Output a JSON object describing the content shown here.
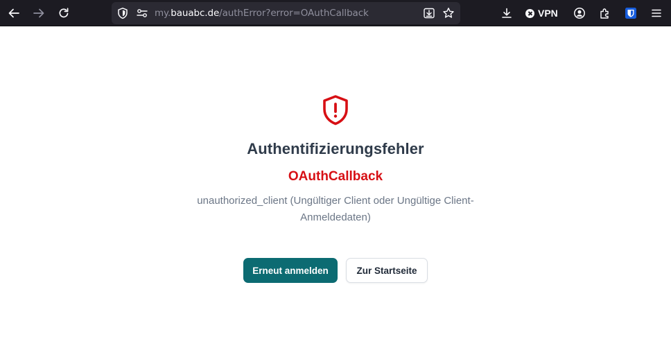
{
  "browser": {
    "url_prefix": "my.",
    "url_host": "bauabc.de",
    "url_path": "/authError?error=OAuthCallback",
    "vpn_label": "VPN",
    "icons": {
      "back": "arrow-left-icon",
      "forward": "arrow-right-icon",
      "reload": "reload-icon",
      "tracking_protection": "shield-icon",
      "permissions": "permissions-icon",
      "save_page": "download-page-icon",
      "bookmark": "star-icon",
      "downloads": "download-icon",
      "vpn_status": "vpn-off-icon",
      "account": "account-icon",
      "extensions": "puzzle-icon",
      "bitwarden": "bitwarden-icon",
      "menu": "hamburger-menu-icon"
    }
  },
  "page": {
    "icon": "shield-alert-icon",
    "title": "Authentifizierungsfehler",
    "error_code": "OAuthCallback",
    "description": "unauthorized_client (Ungültiger Client oder Ungültige Client-Anmeldedaten)",
    "retry_button": "Erneut anmelden",
    "home_button": "Zur Startseite"
  },
  "colors": {
    "error_red": "#d70f14",
    "primary_button": "#0c6b72",
    "title_text": "#2f3b4a",
    "description_text": "#6b7686",
    "toolbar_bg": "#1c1b22",
    "urlbar_bg": "#2b2a33"
  }
}
